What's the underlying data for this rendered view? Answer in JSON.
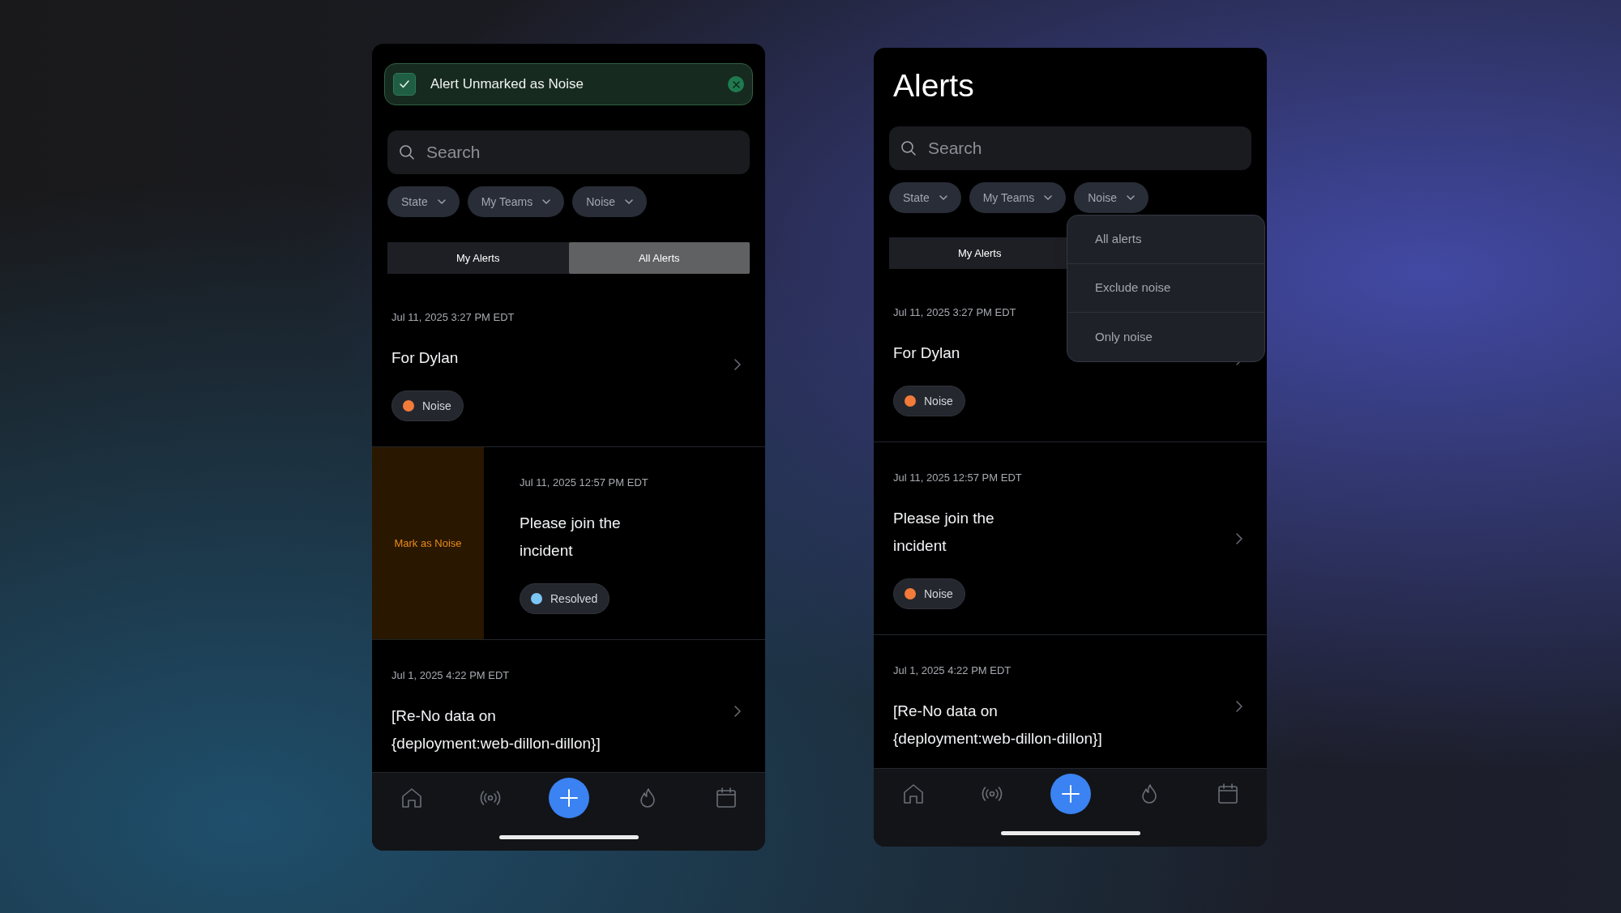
{
  "screens": [
    {
      "toast": {
        "message": "Alert Unmarked as Noise"
      },
      "search": {
        "placeholder": "Search"
      },
      "filters": [
        {
          "label": "State"
        },
        {
          "label": "My Teams"
        },
        {
          "label": "Noise"
        }
      ],
      "segments": [
        {
          "label": "My Alerts",
          "selected": false
        },
        {
          "label": "All Alerts",
          "selected": true
        }
      ],
      "alerts": [
        {
          "time": "Jul 11, 2025 3:27 PM EDT",
          "title": "For Dylan",
          "tag": {
            "label": "Noise",
            "color": "#f27b3a"
          }
        },
        {
          "time": "Jul 11, 2025 12:57 PM EDT",
          "title": "Please join the incident",
          "tag": {
            "label": "Resolved",
            "color": "#7cc6f6"
          },
          "swipe_action": "Mark as Noise"
        },
        {
          "time": "Jul 1, 2025 4:22 PM EDT",
          "title": "[Re-No data on {deployment:web-dillon-dillon}]"
        }
      ]
    },
    {
      "title": "Alerts",
      "search": {
        "placeholder": "Search"
      },
      "filters": [
        {
          "label": "State"
        },
        {
          "label": "My Teams"
        },
        {
          "label": "Noise"
        }
      ],
      "segments": [
        {
          "label": "My Alerts",
          "selected": false
        }
      ],
      "dropdown": {
        "items": [
          {
            "label": "All alerts"
          },
          {
            "label": "Exclude noise"
          },
          {
            "label": "Only noise"
          }
        ]
      },
      "alerts": [
        {
          "time": "Jul 11, 2025 3:27 PM EDT",
          "title": "For Dylan",
          "tag": {
            "label": "Noise",
            "color": "#f27b3a"
          }
        },
        {
          "time": "Jul 11, 2025 12:57 PM EDT",
          "title": "Please join the incident",
          "tag": {
            "label": "Noise",
            "color": "#f27b3a"
          }
        },
        {
          "time": "Jul 1, 2025 4:22 PM EDT",
          "title": "[Re-No data on {deployment:web-dillon-dillon}]"
        }
      ]
    }
  ]
}
